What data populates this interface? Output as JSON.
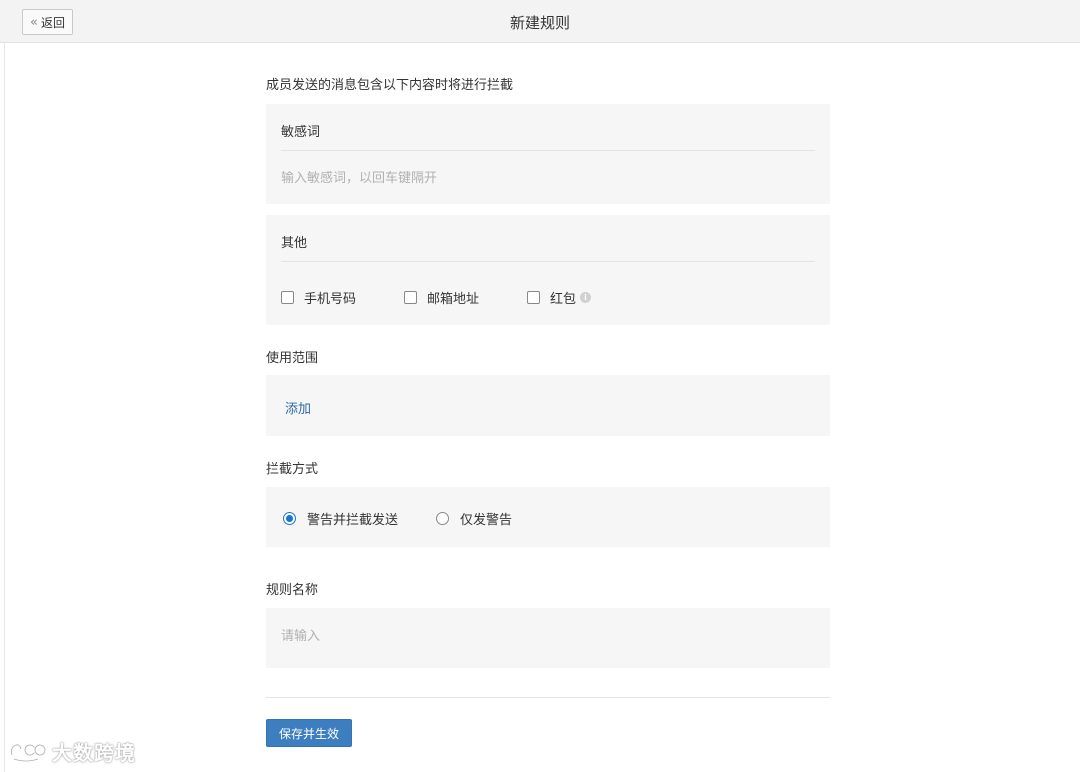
{
  "header": {
    "back_label": "返回",
    "title": "新建规则"
  },
  "form": {
    "intro": "成员发送的消息包含以下内容时将进行拦截",
    "keywords": {
      "title": "敏感词",
      "placeholder": "输入敏感词，以回车键隔开"
    },
    "other": {
      "title": "其他",
      "options": [
        {
          "label": "手机号码",
          "checked": false
        },
        {
          "label": "邮箱地址",
          "checked": false
        },
        {
          "label": "红包",
          "checked": false,
          "has_info": true
        }
      ]
    },
    "scope": {
      "label": "使用范围",
      "add_label": "添加"
    },
    "intercept": {
      "label": "拦截方式",
      "options": [
        {
          "label": "警告并拦截发送",
          "selected": true
        },
        {
          "label": "仅发警告",
          "selected": false
        }
      ]
    },
    "rule_name": {
      "label": "规则名称",
      "placeholder": "请输入"
    },
    "save_label": "保存并生效"
  },
  "watermark": {
    "text": "大数跨境"
  },
  "colors": {
    "accent": "#1677d2",
    "button": "#3d7ec0",
    "link": "#2f6aa6",
    "panel": "#f6f6f6",
    "header": "#f3f3f3"
  }
}
